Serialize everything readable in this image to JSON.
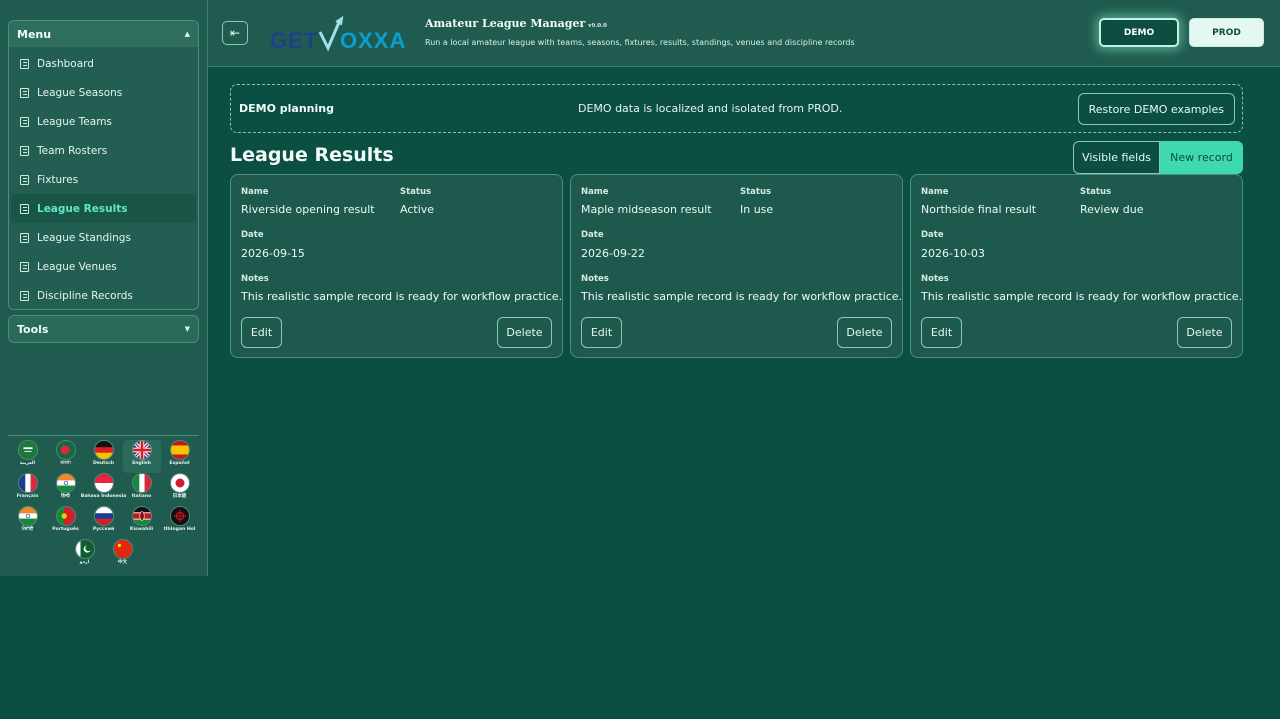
{
  "sidebar": {
    "menu_title": "Menu",
    "tools_title": "Tools",
    "items": [
      {
        "label": "Dashboard"
      },
      {
        "label": "League Seasons"
      },
      {
        "label": "League Teams"
      },
      {
        "label": "Team Rosters"
      },
      {
        "label": "Fixtures"
      },
      {
        "label": "League Results",
        "active": true
      },
      {
        "label": "League Standings"
      },
      {
        "label": "League Venues"
      },
      {
        "label": "Discipline Records"
      }
    ],
    "languages": [
      {
        "label": "العربية",
        "flag": "sa"
      },
      {
        "label": "বাংলা",
        "flag": "bd"
      },
      {
        "label": "Deutsch",
        "flag": "de"
      },
      {
        "label": "English",
        "flag": "gb",
        "selected": true
      },
      {
        "label": "Español",
        "flag": "es"
      },
      {
        "label": "Français",
        "flag": "fr"
      },
      {
        "label": "हिन्दी",
        "flag": "in"
      },
      {
        "label": "Bahasa Indonesia",
        "flag": "id"
      },
      {
        "label": "Italiano",
        "flag": "it"
      },
      {
        "label": "日本語",
        "flag": "jp"
      },
      {
        "label": "ਪੰਜਾਬੀ",
        "flag": "in"
      },
      {
        "label": "Português",
        "flag": "pt"
      },
      {
        "label": "Русский",
        "flag": "ru"
      },
      {
        "label": "Kiswahili",
        "flag": "ke"
      },
      {
        "label": "tlhIngan Hol",
        "flag": "kl"
      },
      {
        "label": "اردو",
        "flag": "pk"
      },
      {
        "label": "中文",
        "flag": "cn"
      }
    ]
  },
  "header": {
    "logo": "GETVOXXA",
    "app_title": "Amateur League Manager",
    "version": "v9.0.0",
    "subtitle": "Run a local amateur league with teams, seasons, fixtures, results, standings, venues and discipline records",
    "demo_label": "DEMO",
    "prod_label": "PROD"
  },
  "banner": {
    "title": "DEMO planning",
    "text": "DEMO data is localized and isolated from PROD.",
    "restore_label": "Restore DEMO examples"
  },
  "main": {
    "title": "League Results",
    "visible_fields_label": "Visible fields",
    "new_record_label": "New record"
  },
  "labels": {
    "name": "Name",
    "status": "Status",
    "date": "Date",
    "notes": "Notes",
    "edit": "Edit",
    "delete": "Delete"
  },
  "cards": [
    {
      "name": "Riverside opening result",
      "status": "Active",
      "date": "2026-09-15",
      "notes": "This realistic sample record is ready for workflow practice."
    },
    {
      "name": "Maple midseason result",
      "status": "In use",
      "date": "2026-09-22",
      "notes": "This realistic sample record is ready for workflow practice."
    },
    {
      "name": "Northside final result",
      "status": "Review due",
      "date": "2026-10-03",
      "notes": "This realistic sample record is ready for workflow practice."
    }
  ],
  "colors": {
    "background": "#0b4f43",
    "panel": "#1f5c4f",
    "accent": "#3fd9b0",
    "active_text": "#5fe8c6"
  }
}
